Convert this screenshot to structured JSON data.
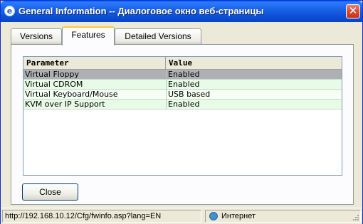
{
  "window": {
    "title": "General Information -- Диалоговое окно веб-страницы",
    "close_glyph": "✕"
  },
  "tabs": [
    {
      "label": "Versions",
      "active": false
    },
    {
      "label": "Features",
      "active": true
    },
    {
      "label": "Detailed Versions",
      "active": false
    }
  ],
  "table": {
    "columns": [
      "Parameter",
      "Value"
    ],
    "rows": [
      {
        "parameter": "Virtual Floppy",
        "value": "Enabled",
        "selected": true
      },
      {
        "parameter": "Virtual CDROM",
        "value": "Enabled",
        "selected": false
      },
      {
        "parameter": "Virtual Keyboard/Mouse",
        "value": "USB based",
        "selected": false
      },
      {
        "parameter": "KVM over IP Support",
        "value": "Enabled",
        "selected": false
      }
    ]
  },
  "buttons": {
    "close_label": "Close"
  },
  "statusbar": {
    "url": "http://192.168.10.12/Cfg/fwinfo.asp?lang=EN",
    "zone": "Интернет"
  },
  "colors": {
    "titlebar": "#0a4fd6",
    "row_selected": "#aeb0b5",
    "row_even": "#e8fbe6",
    "row_odd": "#f5fff4",
    "tab_highlight": "#ffc83c"
  }
}
